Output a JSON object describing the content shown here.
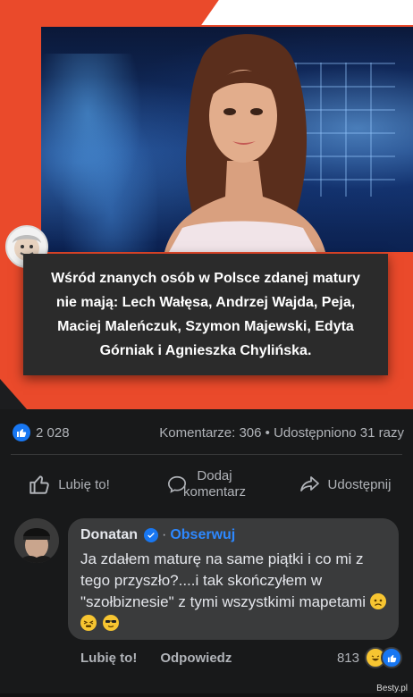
{
  "post": {
    "caption": "Wśród znanych osób w Polsce zdanej matury nie mają: Lech Wałęsa, Andrzej Wajda, Peja, Maciej Maleńczuk, Szymon Majewski, Edyta Górniak i Agnieszka Chylińska.",
    "accent_color": "#ea4a2b"
  },
  "stats": {
    "likes": "2 028",
    "comments_shares": "Komentarze: 306 • Udostępniono 31 razy"
  },
  "actions": {
    "like": "Lubię to!",
    "comment_line1": "Dodaj",
    "comment_line2": "komentarz",
    "share": "Udostępnij"
  },
  "comment": {
    "author": "Donatan",
    "separator": "·",
    "follow": "Obserwuj",
    "text": "Ja zdałem maturę na same piątki i co mi z tego przyszło?....i tak skończyłem w \"szołbiznesie\" z tymi wszystkimi mapetami",
    "emojis": [
      "sad-face-emoji",
      "tired-face-emoji",
      "sunglasses-face-emoji"
    ],
    "like_label": "Lubię to!",
    "reply_label": "Odpowiedz",
    "reactions_count": "813",
    "reaction_icons": [
      "haha-reaction-icon",
      "like-reaction-icon"
    ]
  },
  "watermark": {
    "text": "Besty.pl"
  }
}
